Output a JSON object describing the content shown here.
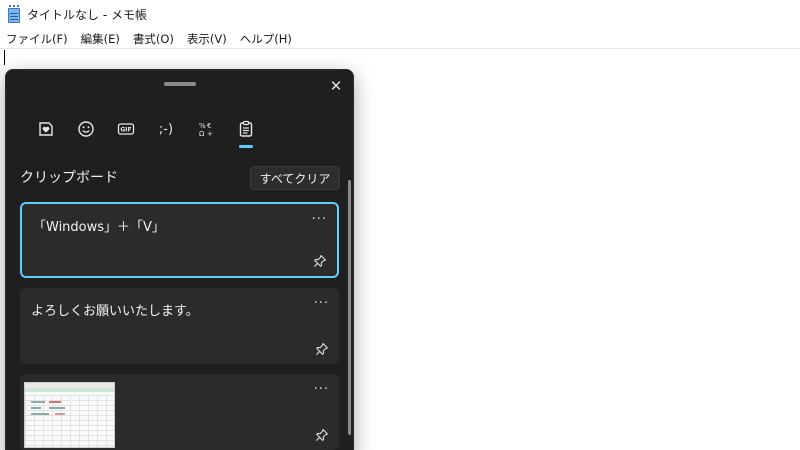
{
  "window": {
    "title": "タイトルなし - メモ帳",
    "icon": "notepad-icon"
  },
  "menu": {
    "items": [
      "ファイル(F)",
      "編集(E)",
      "書式(O)",
      "表示(V)",
      "ヘルプ(H)"
    ]
  },
  "clipboard": {
    "close_icon": "close-icon",
    "tabs": [
      {
        "name": "sticker-tab",
        "icon": "heart-sticker-icon"
      },
      {
        "name": "emoji-tab",
        "icon": "smiley-icon"
      },
      {
        "name": "gif-tab",
        "icon": "gif-icon"
      },
      {
        "name": "kaomoji-tab",
        "label": ";-)"
      },
      {
        "name": "symbols-tab",
        "icon": "symbols-icon"
      },
      {
        "name": "clipboard-tab",
        "icon": "clipboard-icon",
        "active": true
      }
    ],
    "section_title": "クリップボード",
    "clear_all_label": "すべてクリア",
    "items": [
      {
        "text": "「Windows」＋「V」",
        "selected": true
      },
      {
        "text": "よろしくお願いいたします。",
        "selected": false
      },
      {
        "type": "image",
        "selected": false
      }
    ],
    "more_label": "···",
    "accent_color": "#60cdff",
    "panel_color": "#1f1f1f",
    "item_color": "#2b2b2b"
  }
}
